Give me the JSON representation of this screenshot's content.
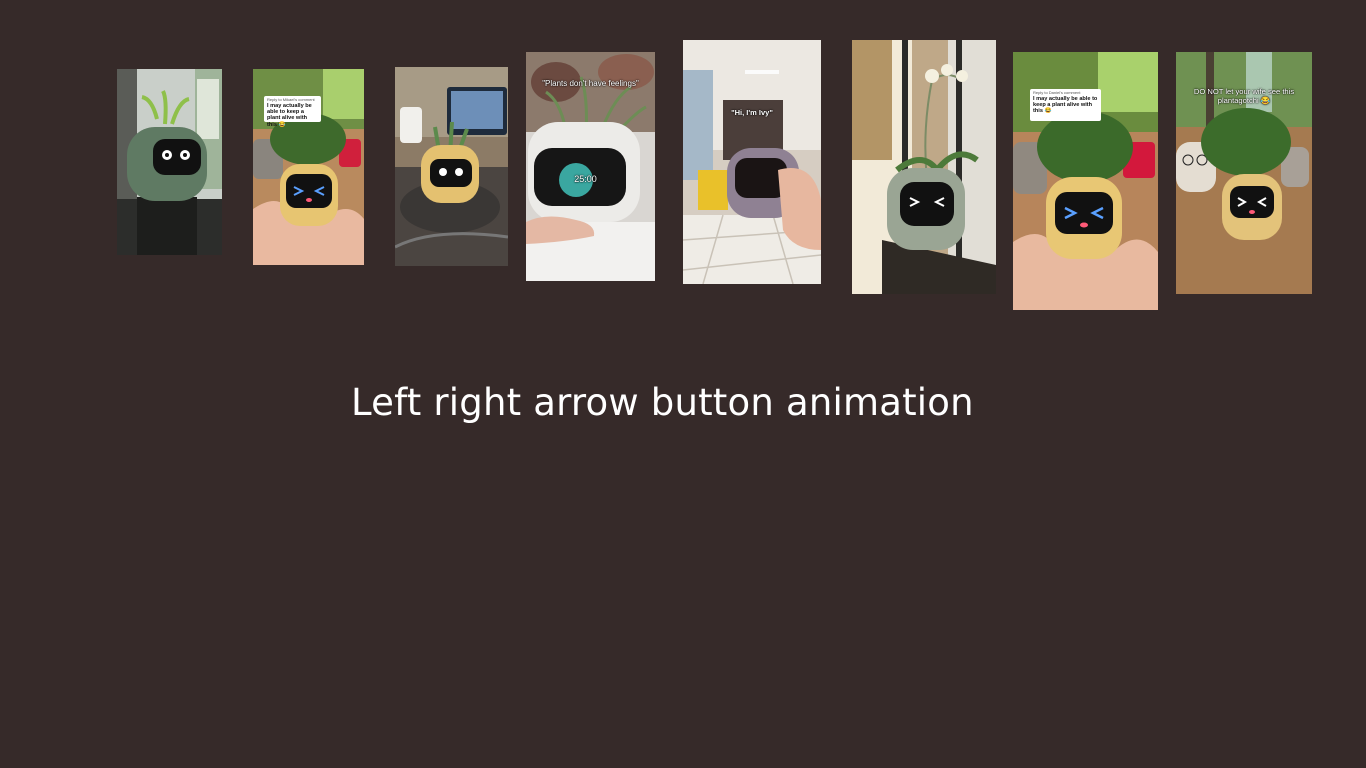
{
  "heading": "Left right arrow button animation",
  "thumbnails": [
    {
      "name": "thumbnail-1-green-planter-robot"
    },
    {
      "name": "thumbnail-2-yellow-planter-in-hand",
      "caption_sub": "Reply to Mikael's comment",
      "caption_main": "I may actually be able to keep a plant alive with this 😂"
    },
    {
      "name": "thumbnail-3-yellow-planter-on-desk"
    },
    {
      "name": "thumbnail-4-white-planter-timer",
      "overlay": "\"Plants don't have feelings\"",
      "screen_text": "25:00"
    },
    {
      "name": "thumbnail-5-lilac-planter-kitchen",
      "overlay": "\"Hi, I'm Ivy\""
    },
    {
      "name": "thumbnail-6-sage-planter-orchid"
    },
    {
      "name": "thumbnail-7-yellow-planter-coffee-plant",
      "caption_sub": "Reply to Daniel's comment",
      "caption_main": "I may actually be able to keep a plant alive with this 😂"
    },
    {
      "name": "thumbnail-8-yellow-planter-table",
      "overlay": "DO NOT let your wife see this plantagotchi 😂"
    }
  ]
}
